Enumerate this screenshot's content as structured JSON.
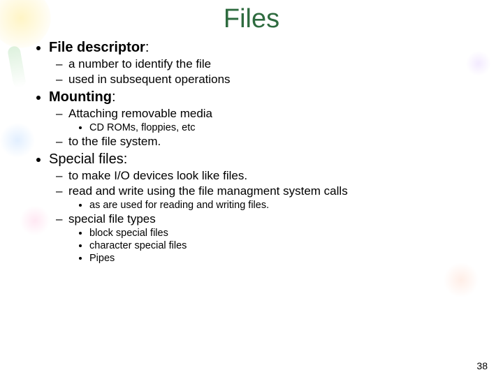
{
  "title": "Files",
  "page_number": "38",
  "bullets": {
    "fd": {
      "heading": "File descriptor",
      "colon": ":",
      "items": [
        "a number to identify the file",
        "used in subsequent operations"
      ]
    },
    "mounting": {
      "heading": "Mounting",
      "colon": ":",
      "items": [
        "Attaching removable media",
        "to the file system."
      ],
      "sub_after_0": [
        "CD ROMs, floppies, etc"
      ]
    },
    "special": {
      "heading": "Special files:",
      "items": [
        "to make I/O devices look like files.",
        "read and write using the file managment system calls",
        "special file types"
      ],
      "sub_after_1": [
        "as are used for reading and writing files."
      ],
      "sub_after_2": [
        "block special files",
        "character special files",
        "Pipes"
      ]
    }
  }
}
